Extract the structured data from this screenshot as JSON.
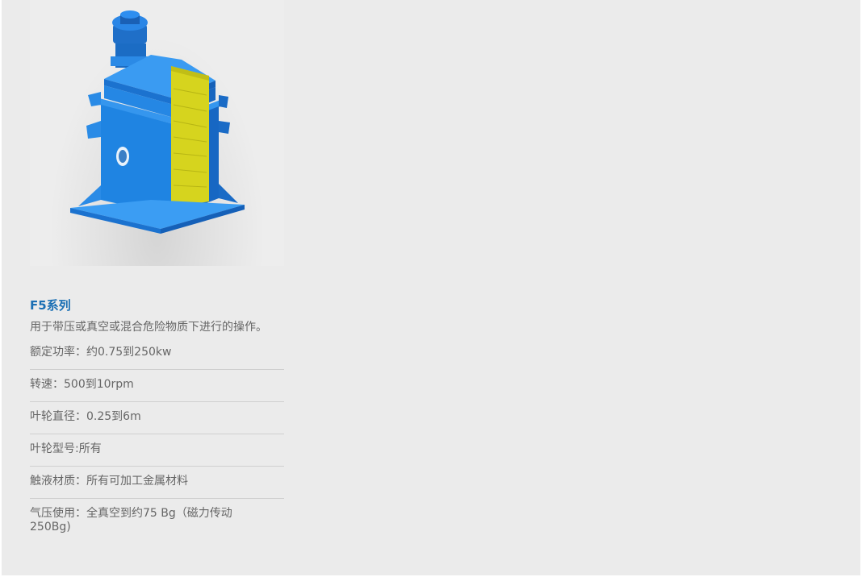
{
  "product": {
    "title": "F5系列",
    "description": "用于带压或真空或混合危险物质下进行的操作。",
    "image_alt": "blue-mixer-machine",
    "specs": [
      "额定功率：约0.75到250kw",
      "转速：500到10rpm",
      "叶轮直径：0.25到6m",
      "叶轮型号:所有",
      "触液材质：所有可加工金属材料",
      "气压使用：全真空到约75 Bg（磁力传动250Bg)"
    ]
  },
  "colors": {
    "title": "#1a6fb4",
    "text": "#666666",
    "machine_blue": "#1e86e0",
    "machine_yellow": "#d6d41e",
    "background": "#ebebeb"
  }
}
